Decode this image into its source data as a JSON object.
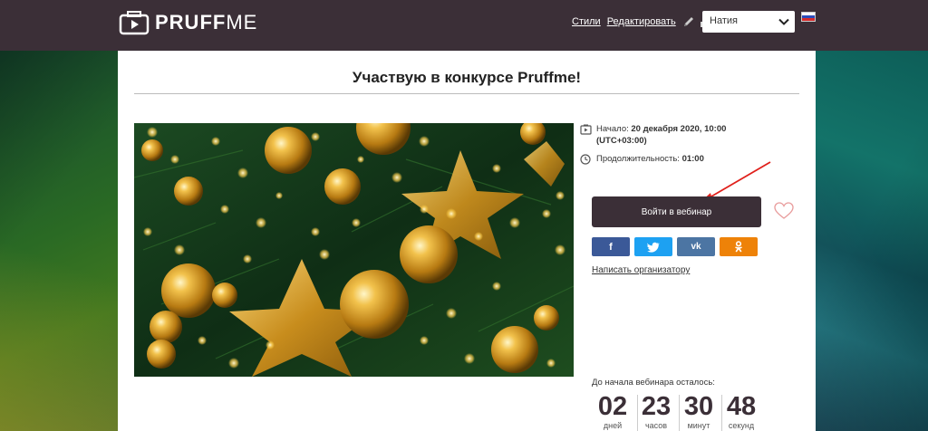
{
  "header": {
    "logo_bold": "PRUFF",
    "logo_thin": "ME",
    "nav_styles": "Стили",
    "nav_edit": "Редактировать",
    "user_select": "Натия",
    "language_flag": "ru"
  },
  "main": {
    "title": "Участвую в конкурсе Pruffme!",
    "start_label": "Начало:",
    "start_value": "20 декабря 2020, 10:00",
    "timezone": "(UTC+03:00)",
    "duration_label": "Продолжительность:",
    "duration_value": "01:00",
    "join_button": "Войти в вебинар",
    "write_organizer": "Написать организатору",
    "share": {
      "facebook": "f",
      "vk": "vk",
      "ok": "ok"
    },
    "countdown_label": "До начала вебинара осталось:",
    "countdown": [
      {
        "value": "02",
        "unit": "дней"
      },
      {
        "value": "23",
        "unit": "часов"
      },
      {
        "value": "30",
        "unit": "минут"
      },
      {
        "value": "48",
        "unit": "секунд"
      }
    ]
  },
  "colors": {
    "header_bg": "#3b2f37",
    "facebook": "#3b5998",
    "twitter": "#1da1f2",
    "vk": "#4c75a3",
    "ok": "#ee8208",
    "arrow": "#e0201b"
  },
  "icons": {
    "logo": "camera-play-icon",
    "pencil": "pencil-icon",
    "stats": "bar-chart-icon",
    "chevron": "chevron-down-icon",
    "calendar": "calendar-play-icon",
    "clock": "clock-icon",
    "heart": "heart-icon"
  }
}
